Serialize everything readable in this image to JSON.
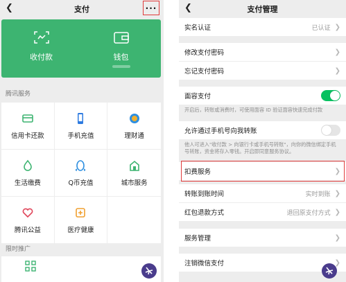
{
  "left": {
    "title": "支付",
    "more_label": "···",
    "wallet_card": {
      "items": [
        {
          "label": "收付款",
          "icon": "scan-qr-icon"
        },
        {
          "label": "钱包",
          "icon": "wallet-icon"
        }
      ]
    },
    "tencent_services": {
      "title": "腾讯服务",
      "items": [
        {
          "label": "信用卡还款",
          "icon": "credit-card-icon",
          "color": "#3db471"
        },
        {
          "label": "手机充值",
          "icon": "mobile-icon",
          "color": "#2e7be0"
        },
        {
          "label": "理财通",
          "icon": "wealth-icon",
          "color": "#2e8fe0"
        },
        {
          "label": "生活缴费",
          "icon": "utility-icon",
          "color": "#3db471"
        },
        {
          "label": "Q币充值",
          "icon": "qq-coin-icon",
          "color": "#2e8fe0"
        },
        {
          "label": "城市服务",
          "icon": "city-icon",
          "color": "#3db471"
        },
        {
          "label": "腾讯公益",
          "icon": "charity-icon",
          "color": "#e0455a"
        },
        {
          "label": "医疗健康",
          "icon": "medical-icon",
          "color": "#f0a030"
        }
      ]
    },
    "promo": {
      "title": "限时推广"
    }
  },
  "right": {
    "title": "支付管理",
    "rows": {
      "real_name": {
        "label": "实名认证",
        "value": "已认证"
      },
      "change_pwd": {
        "label": "修改支付密码"
      },
      "forgot_pwd": {
        "label": "忘记支付密码"
      },
      "face_pay": {
        "label": "面容支付",
        "note": "开启后，转账或消费时，可使用面容 ID 验证面容快速完成付款",
        "on": true
      },
      "phone_transfer": {
        "label": "允许通过手机号向我转账",
        "note": "他人可进入\"收付款 > 向银行卡或手机号转账\"，向你的微信绑定手机号转账，资金将存入零钱。开启即同意服务协议。",
        "on": false
      },
      "deduction": {
        "label": "扣费服务"
      },
      "arrival_time": {
        "label": "转账到账时间",
        "value": "实时到账"
      },
      "red_packet_refund": {
        "label": "红包退款方式",
        "value": "退回原支付方式"
      },
      "service_mgmt": {
        "label": "服务管理"
      },
      "cancel_pay": {
        "label": "注销微信支付"
      }
    }
  },
  "colors": {
    "green": "#3db471",
    "switch_on": "#07c160",
    "highlight": "#e03a3a"
  }
}
